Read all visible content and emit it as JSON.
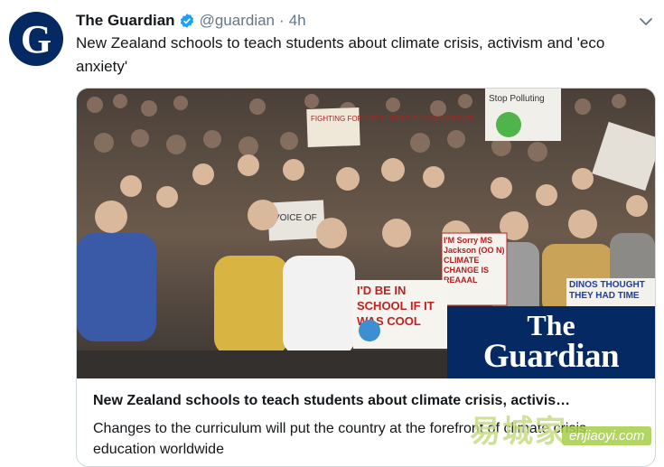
{
  "account": {
    "name": "The Guardian",
    "handle": "@guardian",
    "separator": "·",
    "time": "4h",
    "avatar_letter": "G",
    "avatar_color": "#052962"
  },
  "tweet": {
    "text": "New Zealand schools to teach students about climate crisis, activism and 'eco anxiety'"
  },
  "card": {
    "title": "New Zealand schools to teach students about climate crisis, activis…",
    "description": "Changes to the curriculum will put the country at the forefront of climate crisis education worldwide",
    "image_brand": {
      "line1": "The",
      "line2": "Guardian",
      "color": "#052962"
    },
    "signs": {
      "stop_polluting": "Stop Polluting",
      "fighting": "FIGHTING FOR THE FUTURE OF YOUNGER ME",
      "voice": "VOICE OF",
      "im_sorry": "I'M Sorry MS Jackson (OO N) CLIMATE CHANGE IS REAAAL",
      "school": "I'D BE IN SCHOOL IF IT WAS COOL",
      "dinos": "DINOS THOUGHT THEY HAD TIME"
    }
  },
  "watermark": {
    "chinese": "易城家",
    "latin": "enjiaoyi.com"
  },
  "icons": {
    "verified": "verified-badge-icon",
    "menu": "chevron-down-icon"
  },
  "colors": {
    "verified": "#1da1f2",
    "muted": "#657786",
    "border": "#ccd6dd"
  }
}
